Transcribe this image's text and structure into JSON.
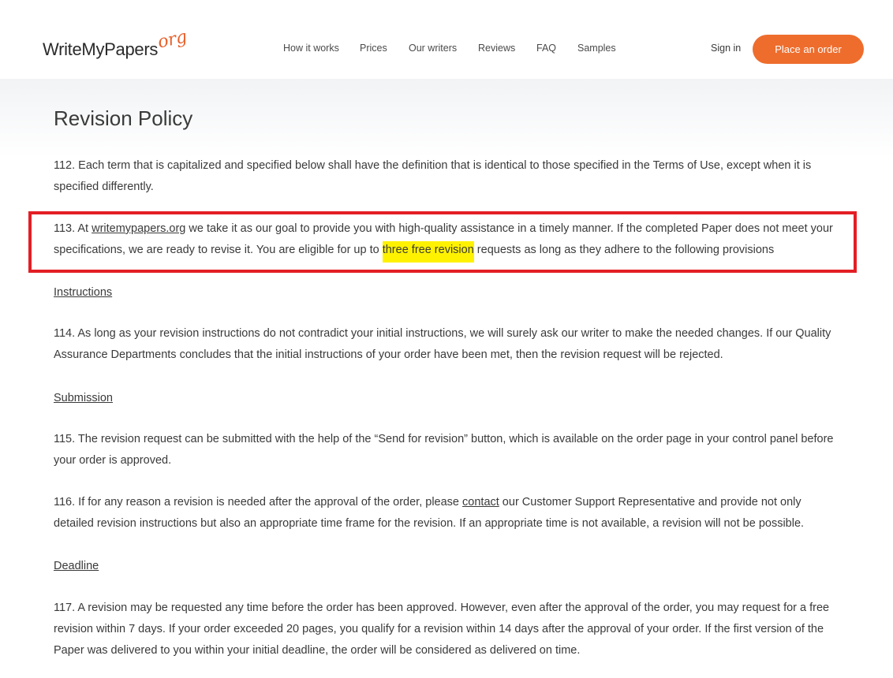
{
  "header": {
    "logo_main": "WriteMyPapers",
    "logo_suffix": "org",
    "nav": [
      "How it works",
      "Prices",
      "Our writers",
      "Reviews",
      "FAQ",
      "Samples"
    ],
    "sign_in": "Sign in",
    "place_order": "Place an order",
    "accent_color": "#ee6d2d"
  },
  "page": {
    "title": "Revision Policy",
    "p112": "112. Each term that is capitalized and specified below shall have the definition that is identical to those specified in the Terms of Use, except when it is specified differently.",
    "p113_a": "113. At ",
    "p113_link": "writemypapers.org",
    "p113_b": " we take it as our goal to provide you with high-quality assistance in a timely manner. If the completed Paper does not meet your specifications, we are ready to revise it. You are eligible for up to ",
    "p113_highlight": "three free revision",
    "p113_c": " requests as long as they adhere to the following provisions",
    "sub_instructions": "Instructions",
    "p114": "114. As long as your revision instructions do not contradict your initial instructions, we will surely ask our writer to make the needed changes. If our Quality Assurance Departments concludes that the initial instructions of your order have been met, then the revision request will be rejected.",
    "sub_submission": "Submission",
    "p115": "115. The revision request can be submitted with the help of the “Send for revision” button, which is available on the order page in your control panel before your order is approved.",
    "p116_a": "116. If for any reason a revision is needed after the approval of the order, please ",
    "p116_link": "contact",
    "p116_b": " our Customer Support Representative and provide not only detailed revision instructions but also an appropriate time frame for the revision. If an appropriate time is not available, a revision will not be possible.",
    "sub_deadline": "Deadline",
    "p117": "117. A revision may be requested any time before the order has been approved. However, even after the approval of the order, you may request for a free revision within 7 days. If your order exceeded 20 pages, you qualify for a revision within 14 days after the approval of your order. If the first version of the Paper was delivered to you within your initial deadline, the order will be considered as delivered on time."
  },
  "annotations": {
    "box_color": "#e31e24",
    "highlight_color": "#fff200"
  }
}
